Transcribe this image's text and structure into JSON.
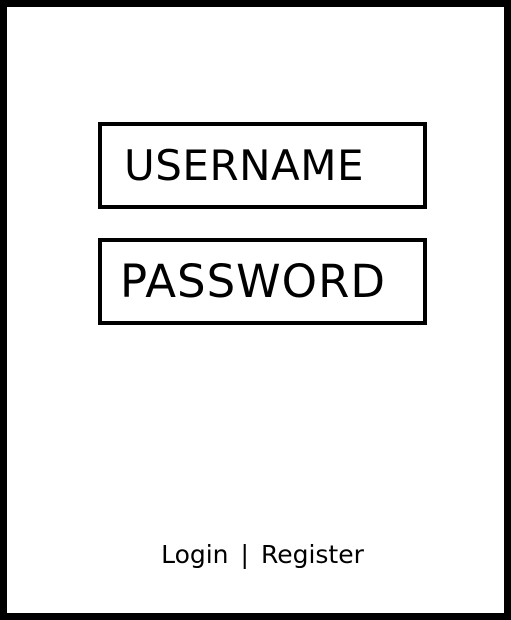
{
  "login_form": {
    "username_label": "USERNAME",
    "password_label": "PASSWORD"
  },
  "footer": {
    "login_label": "Login",
    "separator": "|",
    "register_label": "Register"
  }
}
